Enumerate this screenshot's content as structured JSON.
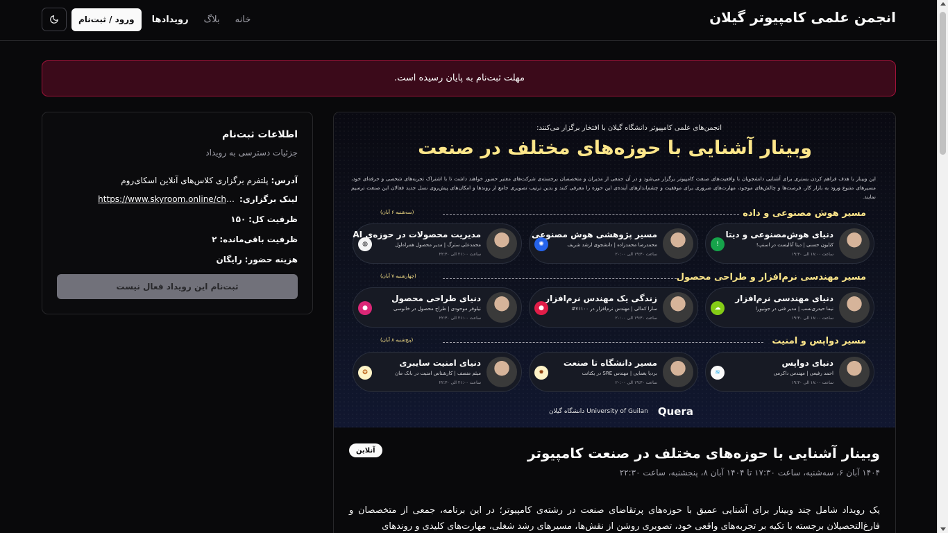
{
  "header": {
    "site_title": "انجمن علمی کامپیوتر گیلان",
    "nav": [
      {
        "label": "خانه"
      },
      {
        "label": "بلاگ"
      },
      {
        "label": "رویدادها"
      }
    ],
    "login_label": "ورود / ثبت‌نام",
    "theme_icon": "moon-icon"
  },
  "alert": {
    "text": "مهلت ثبت‌نام به پایان رسیده است."
  },
  "registration": {
    "title": "اطلاعات ثبت‌نام",
    "subtitle": "جزئیات دسترسی به رویداد",
    "address_label": "آدرس:",
    "address_value": "پلتفرم برگزاری کلاس‌های آنلاین اسکای‌روم",
    "link_label": "لینک برگزاری:",
    "link_value": "https://www.skyroom.online/ch/guilance/webinar",
    "capacity_label": "ظرفیت کل:",
    "capacity_value": "۱۵۰",
    "remaining_label": "ظرفیت باقی‌مانده:",
    "remaining_value": "۲",
    "cost_label": "هزینه حضور:",
    "cost_value": "رایگان",
    "button_label": "ثبت‌نام این رویداد فعال نیست"
  },
  "poster": {
    "intro": "انجمن‌های علمی کامپیوتر دانشگاه گیلان با افتخار برگزار می‌کنند:",
    "title": "وبینار آشنایی با حوزه‌های مختلف در صنعت",
    "description": "این وبینار با هدف فراهم کردن بستری برای آشنایی دانشجویان با واقعیت‌های صنعت کامپیوتر برگزار می‌شود و در آن جمعی از مدیران و متخصصان برجسته‌ی شرکت‌های معتبر حضور خواهند داشت تا با اشتراک تجربه‌های شخصی و حرفه‌ای خود، مسیرهای متنوع ورود به بازار کار، فرصت‌ها و چالش‌های موجود، مهارت‌های ضروری برای موفقیت و چشم‌اندازهای آینده‌ی این حوزه را معرفی کنند و بدین ترتیب تصویری جامع از روندها و امکان‌های پیش‌روی نسل جدید فعالان این صنعت ترسیم نمایند.",
    "tracks": [
      {
        "title": "مسیر هوش مصنوعی و داده",
        "date": "(سه‌شنبه ۶ آبان)",
        "sessions": [
          {
            "title": "دنیای هوش‌مصنوعی و دیتا",
            "speaker": "کتایون حسنی | دیتا آنالیست در اسنپ!",
            "time": "ساعت ۱۸:۰۰ الی ۱۹:۳۰"
          },
          {
            "title": "مسیر پژوهشی هوش مصنوعی",
            "speaker": "محمدرضا محمدزاده | دانشجوی ارشد شریف",
            "time": "ساعت ۱۹:۳۰ الی ۲۰:۰۰"
          },
          {
            "title": "مدیریت محصولات در حوزه‌ی AI",
            "speaker": "محمدعلی سترگ | مدیر محصول همراه‌اول",
            "time": "ساعت ۲۱:۰۰ الی ۲۲:۳۰"
          }
        ]
      },
      {
        "title": "مسیر مهندسی نرم‌افزار و طراحی محصول",
        "date": "(چهارشنبه ۷ آبان)",
        "sessions": [
          {
            "title": "دنیای مهندسی نرم‌افزار",
            "speaker": "نیما حیدری‌نسب | مدیر فنی در جونیورا",
            "time": "ساعت ۱۸:۰۰ الی ۱۹:۳۰"
          },
          {
            "title": "زندگی یک مهندس نرم‌افزار",
            "speaker": "سارا کمالی | مهندس نرم‌افزار در ۷۱۱۰۰#",
            "time": "ساعت ۱۹:۳۰ الی ۲۰:۰۰"
          },
          {
            "title": "دنیای طراحی محصول",
            "speaker": "نیلوفر موحودی | طراح محصول در خانوسی",
            "time": "ساعت ۲۱:۰۰ الی ۲۲:۳۰"
          }
        ]
      },
      {
        "title": "مسیر دواپس و امنیت",
        "date": "(پنج‌شنبه ۸ آبان)",
        "sessions": [
          {
            "title": "دنیای دواپس",
            "speaker": "احمد رفیعی | مهندس داکرمی",
            "time": "ساعت ۱۸:۰۰ الی ۱۹:۳۰"
          },
          {
            "title": "مسیر دانشگاه تا صنعت",
            "speaker": "بردیا یغمایی | مهندس SRE در یکتانت",
            "time": "ساعت ۱۹:۳۰ الی ۲۰:۰۰"
          },
          {
            "title": "دنیای امنیت سایبری",
            "speaker": "میثم منصف | کارشناس امنیت در بانک مان",
            "time": "ساعت ۲۱:۰۰ الی ۲۲:۳۰"
          }
        ]
      }
    ],
    "logo_quera": "Quera",
    "logo_guilan": "دانشگاه گیلان University of Guilan"
  },
  "event": {
    "title": "وبینار آشنایی با حوزه‌های مختلف در صنعت کامپیوتر",
    "badge": "آنلاین",
    "date": "۱۴۰۴ آبان ۶، سه‌شنبه، ساعت ۱۷:۳۰ تا ۱۴۰۴ آبان ۸، پنجشنبه، ساعت ۲۲:۳۰",
    "body": "یک رویداد شامل چند وبینار برای آشنایی عمیق با حوزه‌های پرتقاضای صنعت در رشته‌ی کامپیوتر؛ در این برنامه، جمعی از متخصصان و فارغ‌التحصیلان برجسته با تکیه بر تجربه‌های واقعی خود، تصویری روشن از نقش‌ها، مسیرهای رشد شغلی، مهارت‌های کلیدی و روندهای"
  },
  "colors": {
    "background": "#09090b",
    "alert_bg": "#3b0a1a",
    "alert_border": "#9f1239",
    "poster_accent": "#fde68a"
  }
}
